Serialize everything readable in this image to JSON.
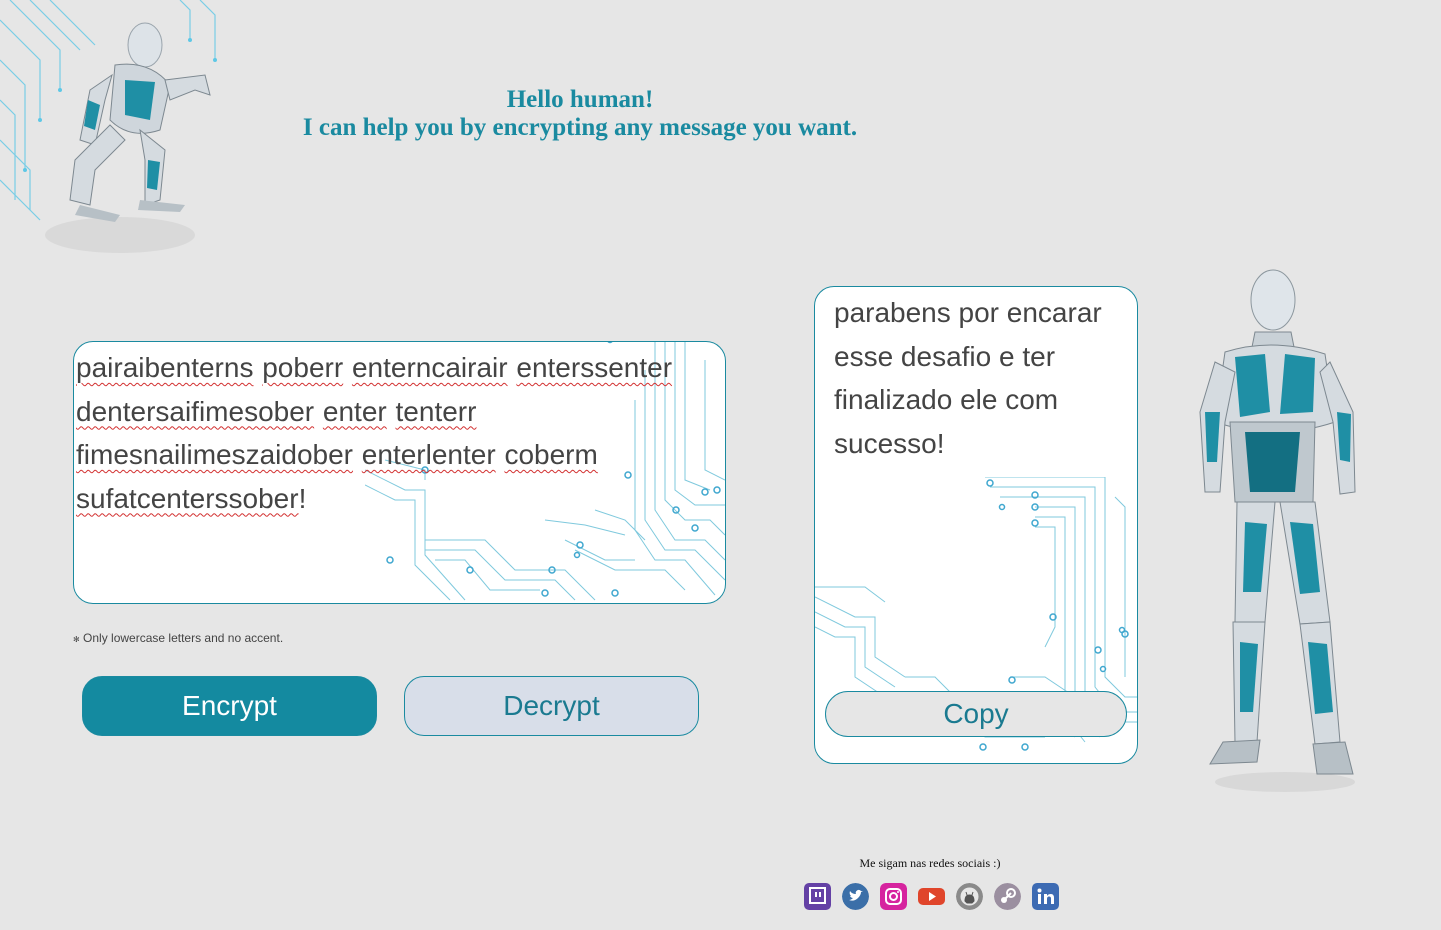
{
  "header": {
    "line1": "Hello human!",
    "line2": "I can help you by encrypting any message you want."
  },
  "input": {
    "words": [
      "pairaibenterns",
      "poberr",
      "enterncairair",
      "enterssenter",
      "dentersaifimesober",
      "enter",
      "tenterr",
      "fimesnailimeszaidober",
      "enterlenter",
      "coberm",
      "sufatcenterssober"
    ],
    "trailing": "!"
  },
  "warning": "Only lowercase letters and no accent.",
  "buttons": {
    "encrypt": "Encrypt",
    "decrypt": "Decrypt",
    "copy": "Copy"
  },
  "output": {
    "text": "parabens por encarar esse desafio e ter finalizado ele com sucesso!"
  },
  "social": {
    "label": "Me sigam nas redes sociais :)",
    "icons": [
      "twitch-icon",
      "twitter-icon",
      "instagram-icon",
      "youtube-icon",
      "github-icon",
      "steam-icon",
      "linkedin-icon"
    ],
    "colors": {
      "twitch": "#6441a5",
      "twitter": "#3b6fa8",
      "instagram": "#d6249f",
      "youtube": "#e0452b",
      "github": "#8a8a8a",
      "steam": "#9b8fa0",
      "linkedin": "#3d6bb3"
    }
  },
  "accent": "#1a8aa0",
  "footer": ""
}
